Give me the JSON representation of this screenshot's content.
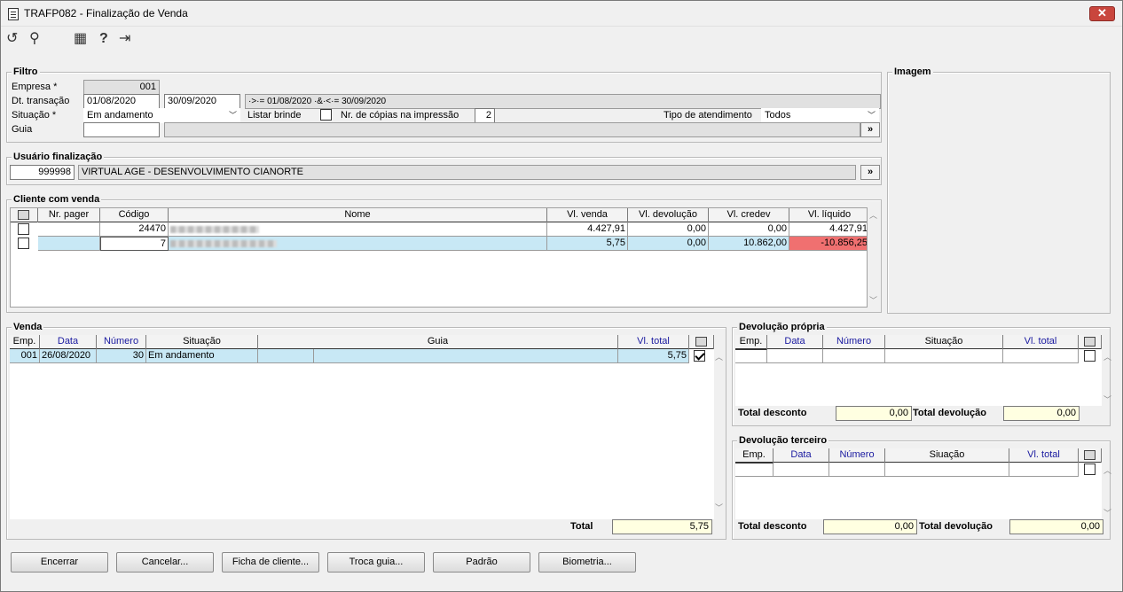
{
  "window": {
    "title": "TRAFP082 - Finalização de Venda",
    "close": "✕"
  },
  "toolbar": {
    "undo": "↺",
    "search": "⚲",
    "calendar": "▦",
    "help": "?",
    "exit": "⇥"
  },
  "filtro": {
    "title": "Filtro",
    "empresa_label": "Empresa *",
    "empresa_value": "001",
    "dt_label": "Dt. transação",
    "dt_from": "01/08/2020",
    "dt_to": "30/09/2020",
    "dt_expr": "·>·= 01/08/2020 ·&·<·= 30/09/2020",
    "situacao_label": "Situação *",
    "situacao_value": "Em andamento",
    "brinde_label": "Listar brinde",
    "copias_label": "Nr. de cópias na impressão",
    "copias_value": "2",
    "tipo_label": "Tipo de atendimento",
    "tipo_value": "Todos",
    "guia_label": "Guia",
    "guia_value": "",
    "more": "»"
  },
  "imagem": {
    "title": "Imagem"
  },
  "usuario": {
    "title": "Usuário finalização",
    "code": "999998",
    "name": "VIRTUAL AGE - DESENVOLVIMENTO CIANORTE",
    "more": "»"
  },
  "cliente": {
    "title": "Cliente com venda",
    "headers": [
      "Nr. pager",
      "Código",
      "Nome",
      "Vl. venda",
      "Vl. devolução",
      "Vl. credev",
      "Vl. líquido"
    ],
    "rows": [
      {
        "pager": "",
        "codigo": "24470",
        "venda": "4.427,91",
        "devolucao": "0,00",
        "credev": "0,00",
        "liquido": "4.427,91"
      },
      {
        "pager": "",
        "codigo": "7",
        "venda": "5,75",
        "devolucao": "0,00",
        "credev": "10.862,00",
        "liquido": "-10.856,25"
      }
    ],
    "negative_color": "#f07070"
  },
  "venda": {
    "title": "Venda",
    "headers": [
      "Emp.",
      "Data",
      "Número",
      "Situação",
      "Guia",
      "Vl. total"
    ],
    "rows": [
      {
        "emp": "001",
        "data": "26/08/2020",
        "numero": "30",
        "situacao": "Em andamento",
        "guia": "",
        "total": "5,75"
      }
    ],
    "total_label": "Total",
    "total_value": "5,75"
  },
  "dev_propria": {
    "title": "Devolução própria",
    "headers": [
      "Emp.",
      "Data",
      "Número",
      "Situação",
      "Vl. total"
    ],
    "desconto_label": "Total desconto",
    "desconto_value": "0,00",
    "devolucao_label": "Total devolução",
    "devolucao_value": "0,00"
  },
  "dev_terceiro": {
    "title": "Devolução terceiro",
    "headers": [
      "Emp.",
      "Data",
      "Número",
      "Siuação",
      "Vl. total"
    ],
    "desconto_label": "Total desconto",
    "desconto_value": "0,00",
    "devolucao_label": "Total devolução",
    "devolucao_value": "0,00"
  },
  "buttons": {
    "encerrar": "Encerrar",
    "cancelar": "Cancelar...",
    "ficha": "Ficha de cliente...",
    "troca": "Troca guia...",
    "padrao": "Padrão",
    "biometria": "Biometria..."
  }
}
